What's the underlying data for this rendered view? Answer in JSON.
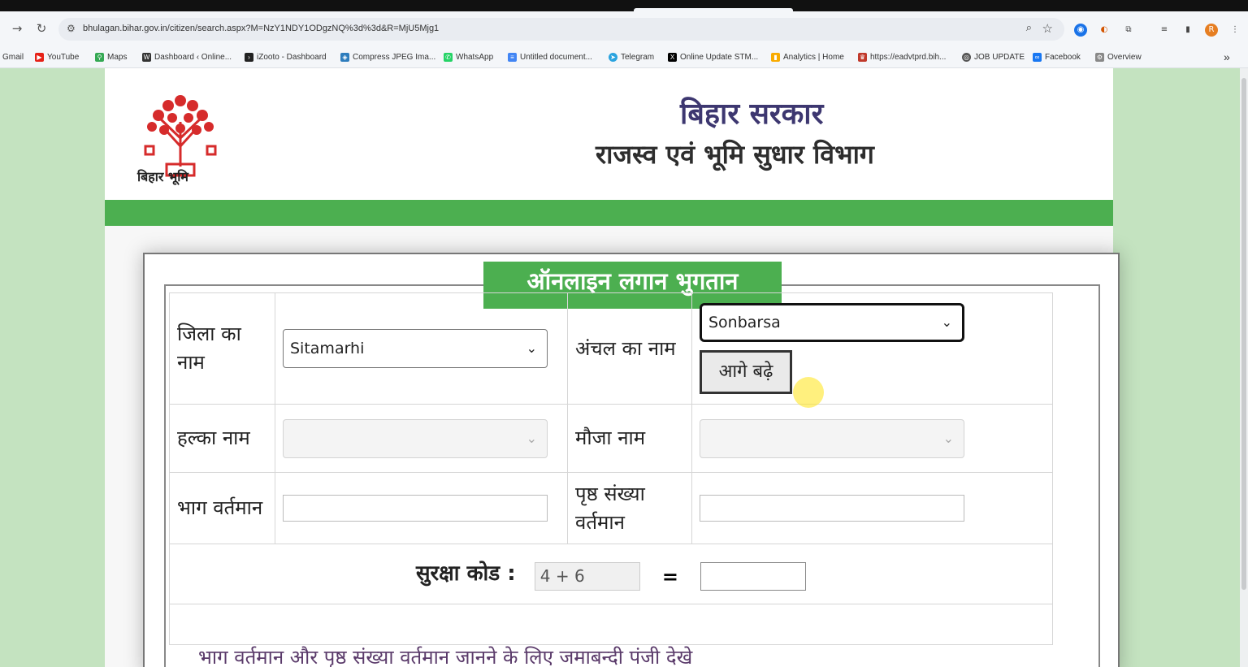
{
  "browser": {
    "url": "bhulagan.bihar.gov.in/citizen/search.aspx?M=NzY1NDY1ODgzNQ%3d%3d&R=MjU5Mjg1",
    "bookmarks": [
      "Gmail",
      "YouTube",
      "Maps",
      "Dashboard ‹ Online...",
      "iZooto - Dashboard",
      "Compress JPEG Ima...",
      "WhatsApp",
      "Untitled document...",
      "Telegram",
      "Online Update STM...",
      "Analytics | Home",
      "https://eadvtprd.bih...",
      "JOB UPDATE",
      "Facebook",
      "Overview"
    ],
    "profile_initial": "R"
  },
  "header": {
    "logo_text": "बिहार भूमि",
    "title_line1": "बिहार सरकार",
    "title_line2": "राजस्व एवं भूमि सुधार विभाग"
  },
  "form": {
    "legend": "ऑनलाइन लगान भुगतान",
    "district_label": "जिला का नाम",
    "district_value": "Sitamarhi",
    "circle_label": "अंचल का नाम",
    "circle_value": "Sonbarsa",
    "next_button": "आगे बढ़े",
    "halka_label": "हल्का नाम",
    "mauja_label": "मौजा नाम",
    "bhag_label": "भाग वर्तमान",
    "page_label": "पृष्ठ संख्या वर्तमान",
    "captcha_label": "सुरक्षा कोड :",
    "captcha_value": "4 + 6",
    "equals": "=",
    "note": "भाग वर्तमान और पृष्ठ संख्या वर्तमान जानने के लिए जमाबन्दी पंजी देखे"
  }
}
